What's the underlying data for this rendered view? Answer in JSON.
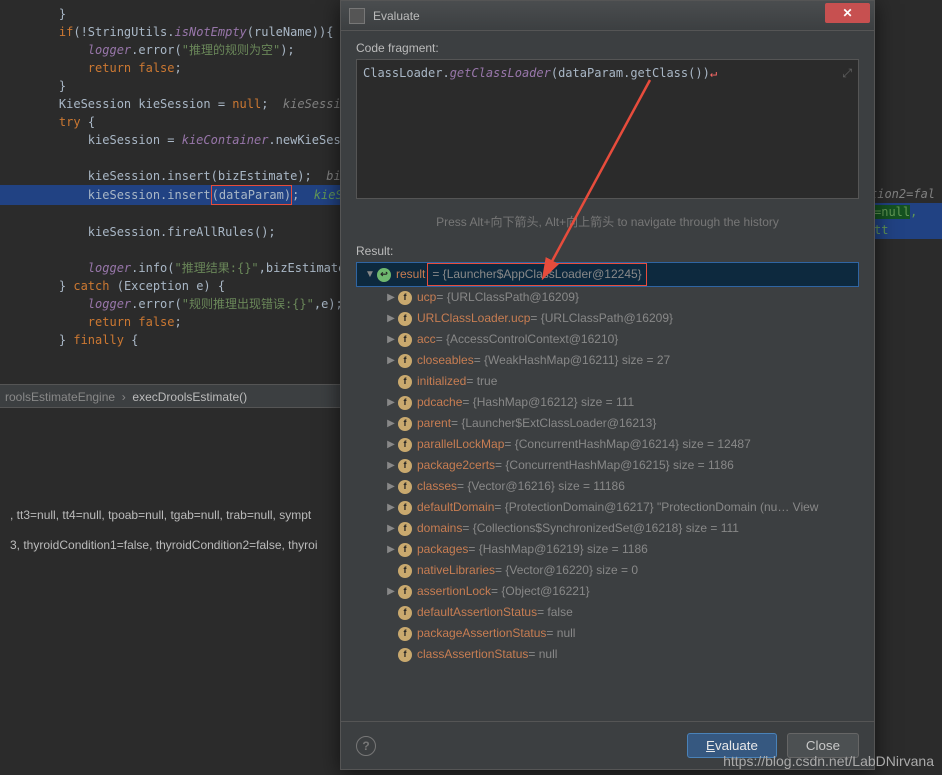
{
  "code": {
    "l1": "}",
    "l2a": "if",
    "l2b": "(!StringUtils.",
    "l2c": "isNotEmpty",
    "l2d": "(ruleName)){",
    "l3a": "logger",
    "l3b": ".error(",
    "l3c": "\"推理的规则为空\"",
    "l3d": ");",
    "l4a": "return false",
    "l4b": ";",
    "l5": "}",
    "l6a": "KieSession kieSession = ",
    "l6b": "null",
    "l6c": ";  ",
    "l6d": "kieSession:",
    "l7a": "try ",
    "l7b": "{",
    "l8a": "kieSession = ",
    "l8b": "kieContainer",
    "l8c": ".newKieSessio",
    "l9a": "kieSession.insert(bizEstimate);  ",
    "l9b": "bizEs",
    "l10a": "kieSession.insert",
    "l10b": "(dataParam)",
    "l10c": ";  ",
    "l10d": "kieSess",
    "l11": "kieSession.fireAllRules();",
    "l12a": "logger",
    "l12b": ".info(",
    "l12c": "\"推理结果:{}\"",
    "l12d": ",bizEstimate.t",
    "l13a": "} ",
    "l13b": "catch ",
    "l13c": "(Exception e) {",
    "l14a": "logger",
    "l14b": ".error(",
    "l14c": "\"规则推理出现错误:{}\"",
    "l14d": ",e);",
    "l15a": "return false",
    "l15b": ";",
    "l16a": "} ",
    "l16b": "finally ",
    "l16c": "{"
  },
  "side": {
    "l1": "tion2=fal",
    "l2a": "=null",
    "l2b": ", tt"
  },
  "breadcrumb": {
    "a": "roolsEstimateEngine",
    "b": "execDroolsEstimate()"
  },
  "bottom": {
    "l1": ", tt3=null, tt4=null, tpoab=null, tgab=null, trab=null, sympt",
    "l2": "3, thyroidCondition1=false, thyroidCondition2=false, thyroi"
  },
  "dialog": {
    "title": "Evaluate",
    "codeFragmentLabel": "Code fragment:",
    "expr": {
      "a": "ClassLoader.",
      "b": "getClassLoader",
      "c": "(dataParam.getClass())"
    },
    "hint": "Press Alt+向下箭头, Alt+向上箭头 to navigate through the history",
    "resultLabel": "Result:"
  },
  "tree": [
    {
      "d": 0,
      "a": "▼",
      "i": "g",
      "name": "result",
      "val": "= {Launcher$AppClassLoader@12245}",
      "sel": true,
      "box": true
    },
    {
      "d": 1,
      "a": "▶",
      "i": "o",
      "name": "ucp",
      "val": "= {URLClassPath@16209}"
    },
    {
      "d": 1,
      "a": "▶",
      "i": "o",
      "name": "URLClassLoader.ucp",
      "val": "= {URLClassPath@16209}"
    },
    {
      "d": 1,
      "a": "▶",
      "i": "o",
      "name": "acc",
      "val": "= {AccessControlContext@16210}"
    },
    {
      "d": 1,
      "a": "▶",
      "i": "o",
      "name": "closeables",
      "val": "= {WeakHashMap@16211}  size = 27"
    },
    {
      "d": 1,
      "a": "",
      "i": "o",
      "name": "initialized",
      "val": "= true"
    },
    {
      "d": 1,
      "a": "▶",
      "i": "o",
      "name": "pdcache",
      "val": "= {HashMap@16212}  size = 111"
    },
    {
      "d": 1,
      "a": "▶",
      "i": "o",
      "name": "parent",
      "val": "= {Launcher$ExtClassLoader@16213}"
    },
    {
      "d": 1,
      "a": "▶",
      "i": "o",
      "name": "parallelLockMap",
      "val": "= {ConcurrentHashMap@16214}  size = 12487"
    },
    {
      "d": 1,
      "a": "▶",
      "i": "o",
      "name": "package2certs",
      "val": "= {ConcurrentHashMap@16215}  size = 1186"
    },
    {
      "d": 1,
      "a": "▶",
      "i": "o",
      "name": "classes",
      "val": "= {Vector@16216}  size = 11186"
    },
    {
      "d": 1,
      "a": "▶",
      "i": "o",
      "name": "defaultDomain",
      "val": "= {ProtectionDomain@16217} \"ProtectionDomain  (nu… View"
    },
    {
      "d": 1,
      "a": "▶",
      "i": "o",
      "name": "domains",
      "val": "= {Collections$SynchronizedSet@16218}  size = 111"
    },
    {
      "d": 1,
      "a": "▶",
      "i": "o",
      "name": "packages",
      "val": "= {HashMap@16219}  size = 1186"
    },
    {
      "d": 1,
      "a": "",
      "i": "o",
      "name": "nativeLibraries",
      "val": "= {Vector@16220}  size = 0"
    },
    {
      "d": 1,
      "a": "▶",
      "i": "o",
      "name": "assertionLock",
      "val": "= {Object@16221}"
    },
    {
      "d": 1,
      "a": "",
      "i": "o",
      "name": "defaultAssertionStatus",
      "val": "= false"
    },
    {
      "d": 1,
      "a": "",
      "i": "o",
      "name": "packageAssertionStatus",
      "val": "= null"
    },
    {
      "d": 1,
      "a": "",
      "i": "o",
      "name": "classAssertionStatus",
      "val": "= null"
    }
  ],
  "buttons": {
    "eval": "Evaluate",
    "close": "Close"
  },
  "watermark": "https://blog.csdn.net/LabDNirvana"
}
